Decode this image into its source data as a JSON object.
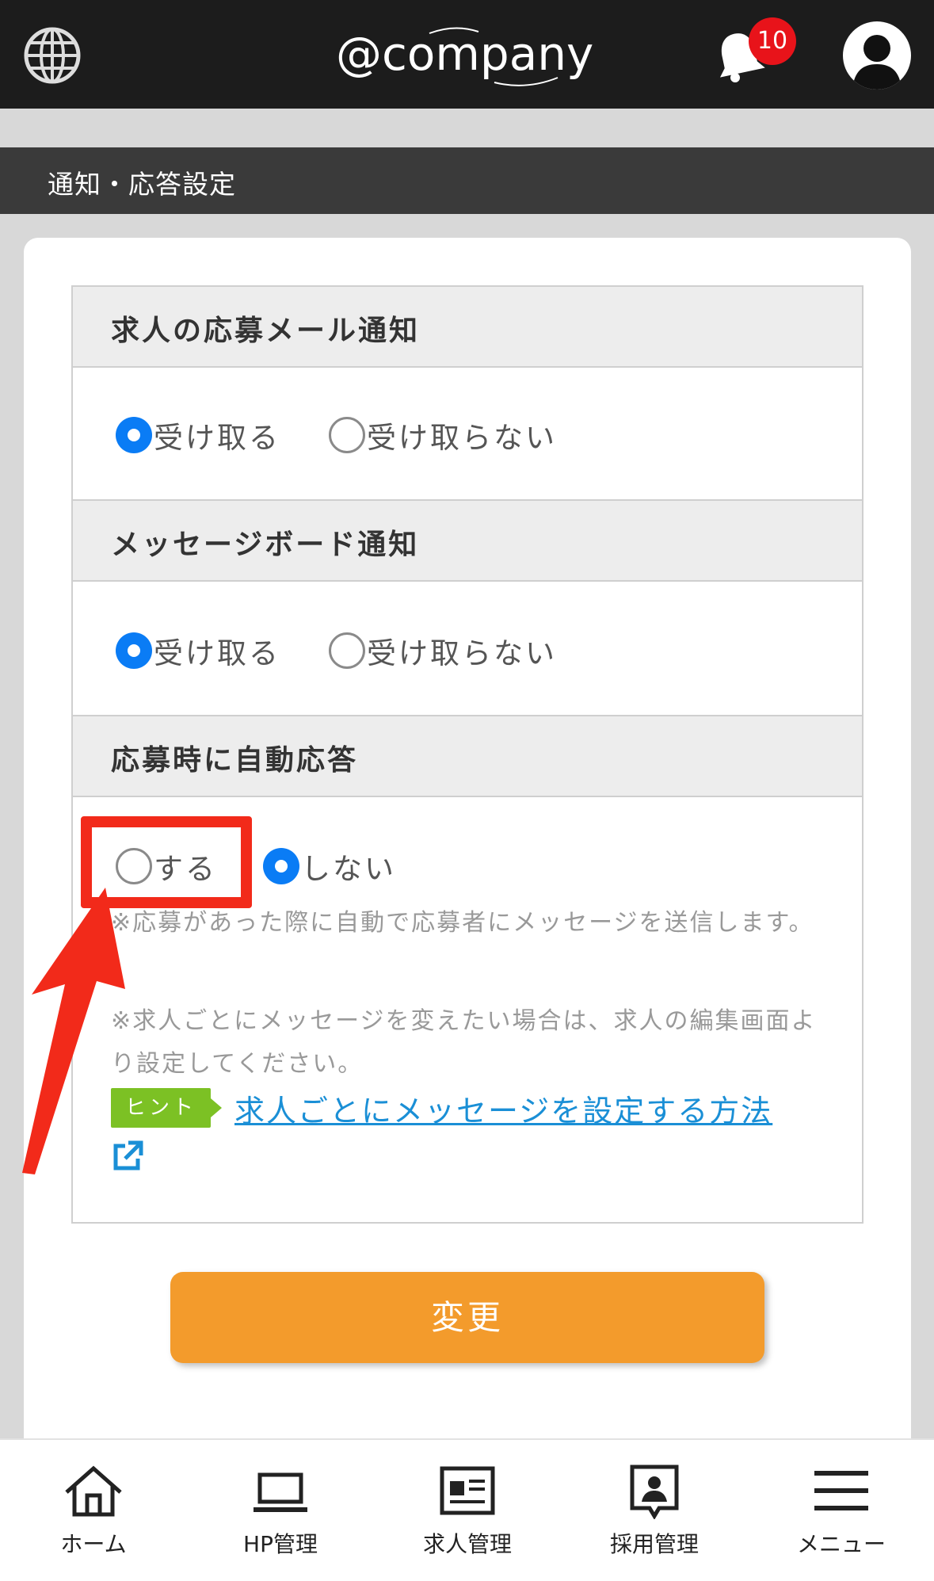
{
  "header": {
    "logo_text": "@company",
    "notification_count": "10"
  },
  "page": {
    "title": "通知・応答設定"
  },
  "sections": [
    {
      "heading": "求人の応募メール通知",
      "options": [
        {
          "label": "受け取る",
          "selected": true
        },
        {
          "label": "受け取らない",
          "selected": false
        }
      ]
    },
    {
      "heading": "メッセージボード通知",
      "options": [
        {
          "label": "受け取る",
          "selected": true
        },
        {
          "label": "受け取らない",
          "selected": false
        }
      ]
    },
    {
      "heading": "応募時に自動応答",
      "options": [
        {
          "label": "する",
          "selected": false
        },
        {
          "label": "しない",
          "selected": true
        }
      ],
      "notes": [
        "※応募があった際に自動で応募者にメッセージを送信します。",
        "※求人ごとにメッセージを変えたい場合は、求人の編集画面より設定してください。"
      ],
      "hint_tag": "ヒント",
      "hint_link": "求人ごとにメッセージを設定する方法"
    }
  ],
  "submit_label": "変更",
  "bottom_nav": [
    {
      "label": "ホーム",
      "icon": "home-icon"
    },
    {
      "label": "HP管理",
      "icon": "laptop-icon"
    },
    {
      "label": "求人管理",
      "icon": "job-listing-icon"
    },
    {
      "label": "採用管理",
      "icon": "person-board-icon"
    },
    {
      "label": "メニュー",
      "icon": "hamburger-menu-icon"
    }
  ],
  "colors": {
    "header_bg": "#1c1c1c",
    "titlebar_bg": "#3a3a3a",
    "radio_selected": "#0a7cf5",
    "badge": "#e8131a",
    "button": "#f39b2c",
    "hint_tag": "#7cc124",
    "link": "#1a8fd6",
    "annotation": "#f22a1a"
  }
}
